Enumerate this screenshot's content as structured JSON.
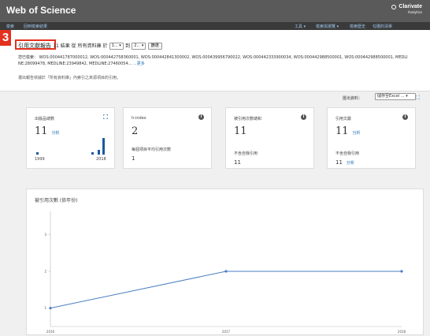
{
  "app": {
    "title": "Web of Science",
    "brand_name": "Clarivate",
    "brand_sub": "Analytics"
  },
  "nav": {
    "left": [
      "檢索",
      "回到檢索結果"
    ],
    "right": [
      "工具 ▾",
      "檢索與瀏覽 ▾",
      "檢索歷史",
      "勾選的清單"
    ]
  },
  "step_badge": "3",
  "citation_row": {
    "title": "引用文獻報告",
    "results_text": "11 結果 從 所有資料庫 於",
    "from_value": "1...",
    "to_label": "到",
    "to_value": "2...",
    "go_label": "篩選"
  },
  "query": {
    "line1": "您已檢索： WOS:000441787000012, WOS:000442758360001, WOS:000442841300002, WOS:000439956790022, WOS:000442333900034, WOS:000442988500001, WOS:000442988500001, MEDLI",
    "line2": "NE:28099478, MEDLINE:23949842, MEDLINE:27460054... ",
    "more": "...更多",
    "note": "選出報告依據於「所有資料庫」內索引之來源項目的引用。"
  },
  "export": {
    "label": "匯出資料：",
    "value": "儲存至Excel ...",
    "icon": "expand-icon"
  },
  "cards": {
    "pubs": {
      "label": "出版品總數",
      "value": "11",
      "link": "分析",
      "year_start": "1999",
      "year_end": "2018",
      "icon": "expand-icon"
    },
    "hindex": {
      "label": "h-index",
      "value": "2",
      "sub_label": "每個項目平均引用次數",
      "sub_value": "1",
      "icon": "info-icon"
    },
    "times_cited": {
      "label": "被引用次數總和",
      "value": "11",
      "sub_label": "不含自我引用",
      "sub_value": "11",
      "icon": "info-icon"
    },
    "citing": {
      "label": "引用文獻",
      "value": "11",
      "link": "分析",
      "sub_label": "不含自我引用",
      "sub_value": "11",
      "sub_link": "分析",
      "icon": "info-icon"
    }
  },
  "colors": {
    "accent": "#e4311f",
    "bar": "#1a5aa0",
    "line": "#4a7fc1",
    "link": "#1a6ab0",
    "topbar": "#5a5a5a"
  },
  "chart_data": {
    "type": "line",
    "title": "被引用次數 (依年份)",
    "x": [
      "2016",
      "2017",
      "2018"
    ],
    "series": [
      {
        "values": [
          1,
          2,
          2
        ]
      }
    ],
    "yticks": [
      "1",
      "2",
      "3"
    ],
    "ylim": [
      0.5,
      3.5
    ],
    "grid": false
  }
}
